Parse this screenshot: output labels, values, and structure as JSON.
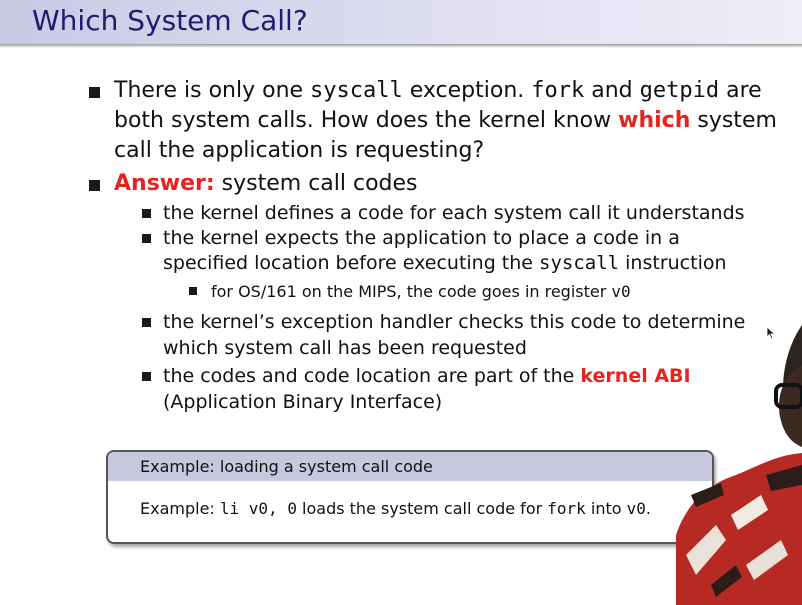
{
  "title": "Which System Call?",
  "bullets": {
    "b1": {
      "line1": {
        "a": "There is only one ",
        "b": "syscall",
        "c": " exception. ",
        "d": "fork",
        "e": " and ",
        "f": "getpid",
        "g": " are"
      },
      "line2": {
        "a": "both system calls. How does the kernel know ",
        "b": "which",
        "c": " system"
      },
      "line3": "call the application is requesting?"
    },
    "b2": {
      "label": "Answer:",
      "text": " system call codes"
    },
    "s1": "the kernel defines a code for each system call it understands",
    "s2": {
      "line1": "the kernel expects the application to place a code in a",
      "line2a": "specified location before executing the ",
      "line2b": "syscall",
      "line2c": " instruction"
    },
    "t1": {
      "a": "for OS/161 on the MIPS, the code goes in register ",
      "b": "v0"
    },
    "s3": {
      "line1": "the kernel’s exception handler checks this code to determine",
      "line2": "which system call has been requested"
    },
    "s4": {
      "line1a": "the codes and code location are part of the ",
      "line1b": "kernel ABI",
      "line2": "(Application Binary Interface)"
    }
  },
  "example": {
    "heading": "Example: loading a system call code",
    "body": {
      "a": "Example: ",
      "b": "li v0, 0",
      "c": " loads the system call code for ",
      "d": "fork",
      "e": " into ",
      "f": "v0",
      "g": "."
    }
  },
  "colors": {
    "accent_red": "#e8231e",
    "title_blue": "#1d1d6e",
    "block_header": "#c7c7e0"
  }
}
